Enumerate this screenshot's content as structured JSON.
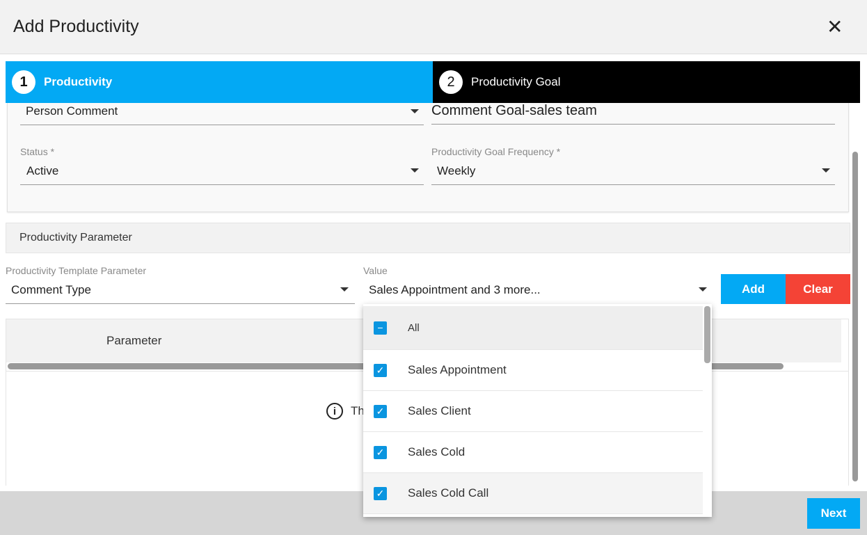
{
  "dialog": {
    "title": "Add Productivity",
    "close_icon": "close-icon"
  },
  "steps": [
    {
      "number": "1",
      "label": "Productivity",
      "active": true,
      "color": "#03a9f4"
    },
    {
      "number": "2",
      "label": "Productivity Goal",
      "active": false,
      "color": "#000000"
    }
  ],
  "form": {
    "type_value": "Person Comment",
    "goal_name_value": "Comment Goal-sales team",
    "status_label": "Status *",
    "status_value": "Active",
    "frequency_label": "Productivity Goal Frequency *",
    "frequency_value": "Weekly"
  },
  "parameter_section": {
    "title": "Productivity Parameter",
    "template_param_label": "Productivity Template Parameter",
    "template_param_value": "Comment Type",
    "value_label": "Value",
    "value_value": "Sales Appointment and 3 more...",
    "add_label": "Add",
    "clear_label": "Clear"
  },
  "table": {
    "columns": [
      "Parameter"
    ],
    "empty_text": "Th"
  },
  "dropdown": {
    "options": [
      {
        "label": "All",
        "state": "indeterminate"
      },
      {
        "label": "Sales Appointment",
        "state": "checked"
      },
      {
        "label": "Sales Client",
        "state": "checked"
      },
      {
        "label": "Sales Cold",
        "state": "checked"
      },
      {
        "label": "Sales Cold Call",
        "state": "checked"
      }
    ]
  },
  "footer": {
    "next_label": "Next"
  }
}
